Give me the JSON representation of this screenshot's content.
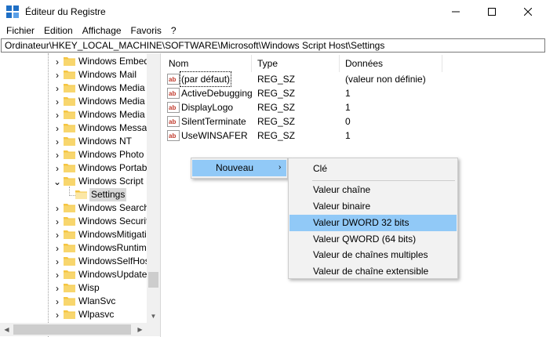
{
  "window": {
    "title": "Éditeur du Registre",
    "minimize_glyph": "—",
    "maximize_glyph": "☐",
    "close_glyph": "✕"
  },
  "menubar": [
    "Fichier",
    "Edition",
    "Affichage",
    "Favoris",
    "?"
  ],
  "address": "Ordinateur\\HKEY_LOCAL_MACHINE\\SOFTWARE\\Microsoft\\Windows Script Host\\Settings",
  "tree": {
    "items": [
      {
        "label": "Windows Embedded",
        "expander": "›"
      },
      {
        "label": "Windows Mail",
        "expander": "›"
      },
      {
        "label": "Windows Media Device Manager",
        "expander": "›"
      },
      {
        "label": "Windows Media Foundation",
        "expander": "›"
      },
      {
        "label": "Windows Media Player NSS",
        "expander": "›"
      },
      {
        "label": "Windows Messaging Subsystem",
        "expander": "›"
      },
      {
        "label": "Windows NT",
        "expander": "›"
      },
      {
        "label": "Windows Photo Viewer",
        "expander": "›"
      },
      {
        "label": "Windows Portable Devices",
        "expander": "›"
      },
      {
        "label": "Windows Script Host",
        "expander": "⌄"
      },
      {
        "label": "Settings",
        "expander": ""
      },
      {
        "label": "Windows Search",
        "expander": "›"
      },
      {
        "label": "Windows Security Health",
        "expander": "›"
      },
      {
        "label": "WindowsMitigation",
        "expander": "›"
      },
      {
        "label": "WindowsRuntime",
        "expander": "›"
      },
      {
        "label": "WindowsSelfHost",
        "expander": "›"
      },
      {
        "label": "WindowsUpdate",
        "expander": "›"
      },
      {
        "label": "Wisp",
        "expander": "›"
      },
      {
        "label": "WlanSvc",
        "expander": "›"
      },
      {
        "label": "Wlpasvc",
        "expander": "›"
      }
    ]
  },
  "list": {
    "headers": {
      "name": "Nom",
      "type": "Type",
      "data": "Données"
    },
    "rows": [
      {
        "name": "(par défaut)",
        "type": "REG_SZ",
        "data": "(valeur non définie)"
      },
      {
        "name": "ActiveDebugging",
        "type": "REG_SZ",
        "data": "1"
      },
      {
        "name": "DisplayLogo",
        "type": "REG_SZ",
        "data": "1"
      },
      {
        "name": "SilentTerminate",
        "type": "REG_SZ",
        "data": "0"
      },
      {
        "name": "UseWINSAFER",
        "type": "REG_SZ",
        "data": "1"
      }
    ],
    "icon_text": "ab"
  },
  "context_menu": {
    "nouveau_label": "Nouveau",
    "submenu_arrow": "›"
  },
  "submenu": {
    "items": [
      {
        "label": "Clé"
      },
      {
        "label": "Valeur chaîne"
      },
      {
        "label": "Valeur binaire"
      },
      {
        "label": "Valeur DWORD 32 bits"
      },
      {
        "label": "Valeur QWORD (64 bits)"
      },
      {
        "label": "Valeur de chaînes multiples"
      },
      {
        "label": "Valeur de chaîne extensible"
      }
    ],
    "highlighted_index": 3
  },
  "colors": {
    "hover": "#91c9f7",
    "menu_bg": "#f2f2f2",
    "folder": "#f5c542",
    "regsz_icon": "#c0392b"
  }
}
